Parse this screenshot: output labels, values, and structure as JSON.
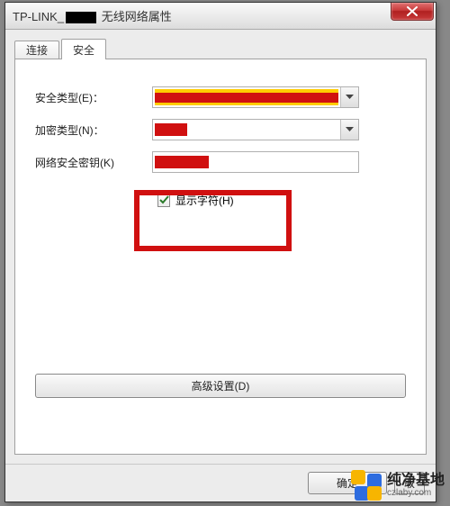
{
  "titlebar": {
    "prefix": "TP-LINK_",
    "suffix": " 无线网络属性"
  },
  "tabs": {
    "connection": "连接",
    "security": "安全"
  },
  "form": {
    "security_type_label": "安全类型(E)：",
    "encryption_type_label": "加密类型(N)：",
    "network_key_label": "网络安全密钥(K)",
    "show_chars_label": "显示字符(H)"
  },
  "buttons": {
    "advanced": "高级设置(D)",
    "ok": "确定",
    "cancel": "取"
  },
  "watermark": {
    "line1": "纯净基地",
    "line2": "czlaby.com"
  }
}
